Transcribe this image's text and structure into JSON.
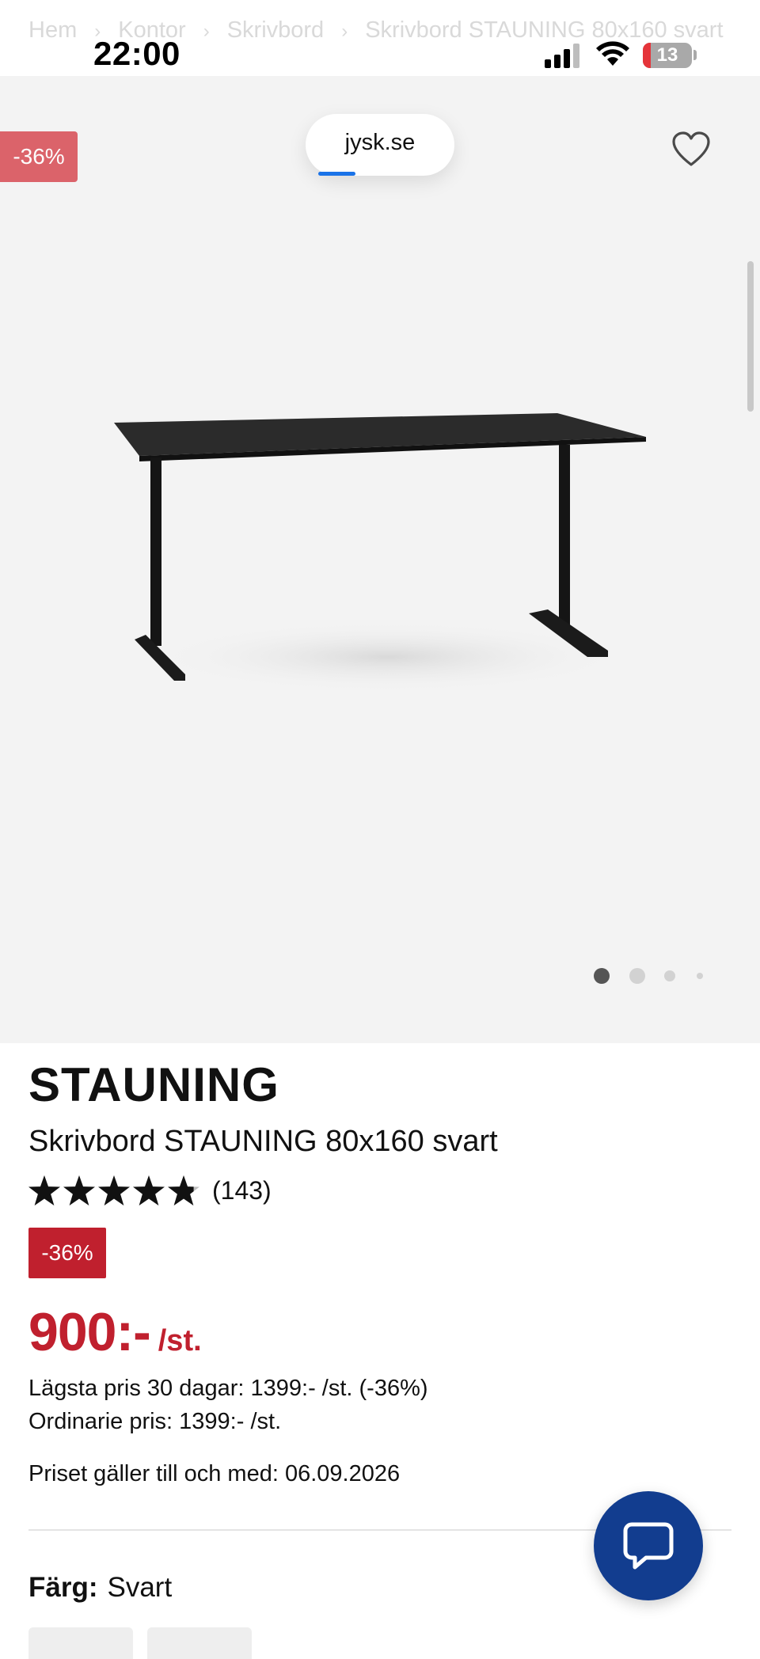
{
  "status_bar": {
    "time": "22:00",
    "battery_level": "13",
    "icons": [
      "cellular-signal-icon",
      "wifi-icon",
      "battery-icon"
    ]
  },
  "breadcrumb": {
    "items": [
      "Hem",
      "Kontor",
      "Skrivbord",
      "Skrivbord STAUNING 80x160 svart"
    ],
    "separator_icon": "chevron-right-icon"
  },
  "browser": {
    "url": "jysk.se",
    "load_progress": 0.25
  },
  "gallery": {
    "discount_label": "-36%",
    "favorite_icon": "heart-icon",
    "image_name": "desk-product-image",
    "dot_count": 4,
    "active_dot": 0
  },
  "product": {
    "brand": "STAUNING",
    "title": "Skrivbord STAUNING 80x160 svart",
    "rating_value": 4.8,
    "rating_max": 5,
    "review_count": "(143)",
    "discount_badge": "-36%",
    "price": "900:-",
    "price_unit": "/st.",
    "lowest_price_30_days": "Lägsta pris 30 dagar: 1399:- /st. (-36%)",
    "regular_price": "Ordinarie pris: 1399:- /st.",
    "valid_until": "Priset gäller till och med: 06.09.2026",
    "color_label": "Färg:",
    "color_value": "Svart"
  },
  "chat": {
    "icon": "chat-bubble-icon"
  },
  "colors": {
    "accent_red": "#c0202e",
    "chat_blue": "#123d8f",
    "gallery_bg": "#f3f3f3"
  }
}
